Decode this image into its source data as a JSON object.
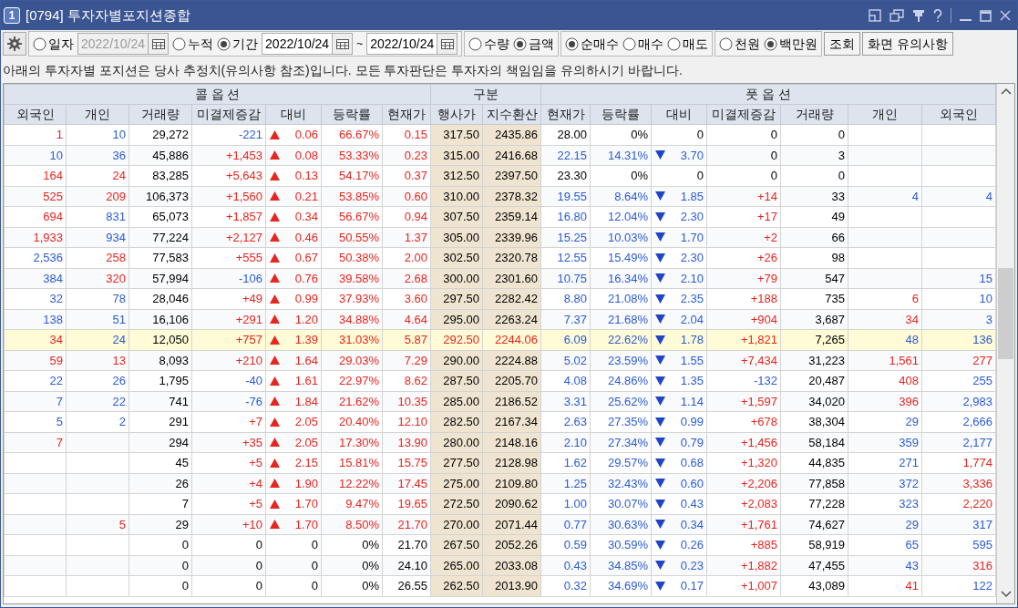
{
  "window": {
    "badge": "1",
    "title": "[0794] 투자자별포지션종합"
  },
  "toolbar": {
    "period_options": [
      {
        "label": "일자",
        "selected": false
      },
      {
        "label": "누적",
        "selected": false
      },
      {
        "label": "기간",
        "selected": true
      }
    ],
    "single_date": {
      "value": "2022/10/24",
      "disabled": true
    },
    "start_date": {
      "value": "2022/10/24",
      "disabled": false
    },
    "range_separator": "~",
    "end_date": {
      "value": "2022/10/24",
      "disabled": false
    },
    "measure_options": [
      {
        "label": "수량",
        "selected": false
      },
      {
        "label": "금액",
        "selected": true
      }
    ],
    "trade_options": [
      {
        "label": "순매수",
        "selected": true
      },
      {
        "label": "매수",
        "selected": false
      },
      {
        "label": "매도",
        "selected": false
      }
    ],
    "unit_options": [
      {
        "label": "천원",
        "selected": false
      },
      {
        "label": "백만원",
        "selected": true
      }
    ],
    "buttons": [
      "조회",
      "화면 유의사항"
    ]
  },
  "notice": "아래의 투자자별 포지션은 당사 추정치(유의사항 참조)입니다. 모든 투자판단은 투자자의 책임임을 유의하시기 바랍니다.",
  "table": {
    "groups": [
      "콜 옵 션",
      "구분",
      "풋 옵 션"
    ],
    "columns": [
      "외국인",
      "개인",
      "거래량",
      "미결제증감",
      "대비",
      "등락률",
      "현재가",
      "행사가",
      "지수환산",
      "현재가",
      "등락률",
      "대비",
      "미결제증감",
      "거래량",
      "개인",
      "외국인"
    ],
    "rows": [
      {
        "selected": false,
        "cells": [
          {
            "text": "1",
            "color": "#e8251e"
          },
          {
            "text": "10",
            "color": "#2a5bd7"
          },
          {
            "text": "29,272"
          },
          {
            "text": "-221",
            "color": "#2a5bd7"
          },
          {
            "text": "0.06",
            "color": "#e8251e",
            "kind": "up"
          },
          {
            "text": "66.67%",
            "color": "#e8251e"
          },
          {
            "text": "0.15",
            "color": "#e8251e"
          },
          {
            "text": "317.50"
          },
          {
            "text": "2435.86"
          },
          {
            "text": "28.00"
          },
          {
            "text": "0%"
          },
          {
            "text": "0"
          },
          {
            "text": "0"
          },
          {
            "text": "0"
          },
          null,
          null
        ]
      },
      {
        "selected": false,
        "cells": [
          {
            "text": "10",
            "color": "#2a5bd7"
          },
          {
            "text": "36",
            "color": "#2a5bd7"
          },
          {
            "text": "45,886"
          },
          {
            "text": "+1,453",
            "color": "#e8251e"
          },
          {
            "text": "0.08",
            "color": "#e8251e",
            "kind": "up"
          },
          {
            "text": "53.33%",
            "color": "#e8251e"
          },
          {
            "text": "0.23",
            "color": "#e8251e"
          },
          {
            "text": "315.00"
          },
          {
            "text": "2416.68"
          },
          {
            "text": "22.15",
            "color": "#2a5bd7"
          },
          {
            "text": "14.31%",
            "color": "#2a5bd7"
          },
          {
            "text": "3.70",
            "color": "#2a5bd7",
            "kind": "down"
          },
          {
            "text": "0"
          },
          {
            "text": "3"
          },
          null,
          null
        ]
      },
      {
        "selected": false,
        "cells": [
          {
            "text": "164",
            "color": "#e8251e"
          },
          {
            "text": "24",
            "color": "#e8251e"
          },
          {
            "text": "83,285"
          },
          {
            "text": "+5,643",
            "color": "#e8251e"
          },
          {
            "text": "0.13",
            "color": "#e8251e",
            "kind": "up"
          },
          {
            "text": "54.17%",
            "color": "#e8251e"
          },
          {
            "text": "0.37",
            "color": "#e8251e"
          },
          {
            "text": "312.50"
          },
          {
            "text": "2397.50"
          },
          {
            "text": "23.30"
          },
          {
            "text": "0%"
          },
          {
            "text": "0"
          },
          {
            "text": "0"
          },
          {
            "text": "0"
          },
          null,
          null
        ]
      },
      {
        "selected": false,
        "cells": [
          {
            "text": "525",
            "color": "#e8251e"
          },
          {
            "text": "209",
            "color": "#e8251e"
          },
          {
            "text": "106,373"
          },
          {
            "text": "+1,560",
            "color": "#e8251e"
          },
          {
            "text": "0.21",
            "color": "#e8251e",
            "kind": "up"
          },
          {
            "text": "53.85%",
            "color": "#e8251e"
          },
          {
            "text": "0.60",
            "color": "#e8251e"
          },
          {
            "text": "310.00"
          },
          {
            "text": "2378.32"
          },
          {
            "text": "19.55",
            "color": "#2a5bd7"
          },
          {
            "text": "8.64%",
            "color": "#2a5bd7"
          },
          {
            "text": "1.85",
            "color": "#2a5bd7",
            "kind": "down"
          },
          {
            "text": "+14",
            "color": "#e8251e"
          },
          {
            "text": "33"
          },
          {
            "text": "4",
            "color": "#2a5bd7"
          },
          {
            "text": "4",
            "color": "#2a5bd7"
          }
        ]
      },
      {
        "selected": false,
        "cells": [
          {
            "text": "694",
            "color": "#e8251e"
          },
          {
            "text": "831",
            "color": "#2a5bd7"
          },
          {
            "text": "65,073"
          },
          {
            "text": "+1,857",
            "color": "#e8251e"
          },
          {
            "text": "0.34",
            "color": "#e8251e",
            "kind": "up"
          },
          {
            "text": "56.67%",
            "color": "#e8251e"
          },
          {
            "text": "0.94",
            "color": "#e8251e"
          },
          {
            "text": "307.50"
          },
          {
            "text": "2359.14"
          },
          {
            "text": "16.80",
            "color": "#2a5bd7"
          },
          {
            "text": "12.04%",
            "color": "#2a5bd7"
          },
          {
            "text": "2.30",
            "color": "#2a5bd7",
            "kind": "down"
          },
          {
            "text": "+17",
            "color": "#e8251e"
          },
          {
            "text": "49"
          },
          null,
          null
        ]
      },
      {
        "selected": false,
        "cells": [
          {
            "text": "1,933",
            "color": "#e8251e"
          },
          {
            "text": "934",
            "color": "#2a5bd7"
          },
          {
            "text": "77,224"
          },
          {
            "text": "+2,127",
            "color": "#e8251e"
          },
          {
            "text": "0.46",
            "color": "#e8251e",
            "kind": "up"
          },
          {
            "text": "50.55%",
            "color": "#e8251e"
          },
          {
            "text": "1.37",
            "color": "#e8251e"
          },
          {
            "text": "305.00"
          },
          {
            "text": "2339.96"
          },
          {
            "text": "15.25",
            "color": "#2a5bd7"
          },
          {
            "text": "10.03%",
            "color": "#2a5bd7"
          },
          {
            "text": "1.70",
            "color": "#2a5bd7",
            "kind": "down"
          },
          {
            "text": "+2",
            "color": "#e8251e"
          },
          {
            "text": "66"
          },
          null,
          null
        ]
      },
      {
        "selected": false,
        "cells": [
          {
            "text": "2,536",
            "color": "#2a5bd7"
          },
          {
            "text": "258",
            "color": "#e8251e"
          },
          {
            "text": "77,583"
          },
          {
            "text": "+555",
            "color": "#e8251e"
          },
          {
            "text": "0.67",
            "color": "#e8251e",
            "kind": "up"
          },
          {
            "text": "50.38%",
            "color": "#e8251e"
          },
          {
            "text": "2.00",
            "color": "#e8251e"
          },
          {
            "text": "302.50"
          },
          {
            "text": "2320.78"
          },
          {
            "text": "12.55",
            "color": "#2a5bd7"
          },
          {
            "text": "15.49%",
            "color": "#2a5bd7"
          },
          {
            "text": "2.30",
            "color": "#2a5bd7",
            "kind": "down"
          },
          {
            "text": "+26",
            "color": "#e8251e"
          },
          {
            "text": "98"
          },
          null,
          null
        ]
      },
      {
        "selected": false,
        "cells": [
          {
            "text": "384",
            "color": "#2a5bd7"
          },
          {
            "text": "320",
            "color": "#e8251e"
          },
          {
            "text": "57,994"
          },
          {
            "text": "-106",
            "color": "#2a5bd7"
          },
          {
            "text": "0.76",
            "color": "#e8251e",
            "kind": "up"
          },
          {
            "text": "39.58%",
            "color": "#e8251e"
          },
          {
            "text": "2.68",
            "color": "#e8251e"
          },
          {
            "text": "300.00"
          },
          {
            "text": "2301.60"
          },
          {
            "text": "10.75",
            "color": "#2a5bd7"
          },
          {
            "text": "16.34%",
            "color": "#2a5bd7"
          },
          {
            "text": "2.10",
            "color": "#2a5bd7",
            "kind": "down"
          },
          {
            "text": "+79",
            "color": "#e8251e"
          },
          {
            "text": "547"
          },
          null,
          {
            "text": "15",
            "color": "#2a5bd7"
          }
        ]
      },
      {
        "selected": false,
        "cells": [
          {
            "text": "32",
            "color": "#2a5bd7"
          },
          {
            "text": "78",
            "color": "#2a5bd7"
          },
          {
            "text": "28,046"
          },
          {
            "text": "+49",
            "color": "#e8251e"
          },
          {
            "text": "0.99",
            "color": "#e8251e",
            "kind": "up"
          },
          {
            "text": "37.93%",
            "color": "#e8251e"
          },
          {
            "text": "3.60",
            "color": "#e8251e"
          },
          {
            "text": "297.50"
          },
          {
            "text": "2282.42"
          },
          {
            "text": "8.80",
            "color": "#2a5bd7"
          },
          {
            "text": "21.08%",
            "color": "#2a5bd7"
          },
          {
            "text": "2.35",
            "color": "#2a5bd7",
            "kind": "down"
          },
          {
            "text": "+188",
            "color": "#e8251e"
          },
          {
            "text": "735"
          },
          {
            "text": "6",
            "color": "#e8251e"
          },
          {
            "text": "10",
            "color": "#2a5bd7"
          }
        ]
      },
      {
        "selected": false,
        "cells": [
          {
            "text": "138",
            "color": "#2a5bd7"
          },
          {
            "text": "51",
            "color": "#2a5bd7"
          },
          {
            "text": "16,106"
          },
          {
            "text": "+291",
            "color": "#e8251e"
          },
          {
            "text": "1.20",
            "color": "#e8251e",
            "kind": "up"
          },
          {
            "text": "34.88%",
            "color": "#e8251e"
          },
          {
            "text": "4.64",
            "color": "#e8251e"
          },
          {
            "text": "295.00"
          },
          {
            "text": "2263.24"
          },
          {
            "text": "7.37",
            "color": "#2a5bd7"
          },
          {
            "text": "21.68%",
            "color": "#2a5bd7"
          },
          {
            "text": "2.04",
            "color": "#2a5bd7",
            "kind": "down"
          },
          {
            "text": "+904",
            "color": "#e8251e"
          },
          {
            "text": "3,687"
          },
          {
            "text": "34",
            "color": "#e8251e"
          },
          {
            "text": "3",
            "color": "#2a5bd7"
          }
        ]
      },
      {
        "selected": true,
        "cells": [
          {
            "text": "34",
            "color": "#e8251e"
          },
          {
            "text": "24",
            "color": "#2a5bd7"
          },
          {
            "text": "12,050"
          },
          {
            "text": "+757",
            "color": "#e8251e"
          },
          {
            "text": "1.39",
            "color": "#e8251e",
            "kind": "up"
          },
          {
            "text": "31.03%",
            "color": "#e8251e"
          },
          {
            "text": "5.87",
            "color": "#e8251e"
          },
          {
            "text": "292.50",
            "color": "#e8251e"
          },
          {
            "text": "2244.06",
            "color": "#e8251e"
          },
          {
            "text": "6.09",
            "color": "#2a5bd7"
          },
          {
            "text": "22.62%",
            "color": "#2a5bd7"
          },
          {
            "text": "1.78",
            "color": "#2a5bd7",
            "kind": "down"
          },
          {
            "text": "+1,821",
            "color": "#e8251e"
          },
          {
            "text": "7,265"
          },
          {
            "text": "48",
            "color": "#2a5bd7"
          },
          {
            "text": "136",
            "color": "#2a5bd7"
          }
        ]
      },
      {
        "selected": false,
        "cells": [
          {
            "text": "59",
            "color": "#e8251e"
          },
          {
            "text": "13",
            "color": "#e8251e"
          },
          {
            "text": "8,093"
          },
          {
            "text": "+210",
            "color": "#e8251e"
          },
          {
            "text": "1.64",
            "color": "#e8251e",
            "kind": "up"
          },
          {
            "text": "29.03%",
            "color": "#e8251e"
          },
          {
            "text": "7.29",
            "color": "#e8251e"
          },
          {
            "text": "290.00"
          },
          {
            "text": "2224.88"
          },
          {
            "text": "5.02",
            "color": "#2a5bd7"
          },
          {
            "text": "23.59%",
            "color": "#2a5bd7"
          },
          {
            "text": "1.55",
            "color": "#2a5bd7",
            "kind": "down"
          },
          {
            "text": "+7,434",
            "color": "#e8251e"
          },
          {
            "text": "31,223"
          },
          {
            "text": "1,561",
            "color": "#e8251e"
          },
          {
            "text": "277",
            "color": "#e8251e"
          }
        ]
      },
      {
        "selected": false,
        "cells": [
          {
            "text": "22",
            "color": "#2a5bd7"
          },
          {
            "text": "26",
            "color": "#2a5bd7"
          },
          {
            "text": "1,795"
          },
          {
            "text": "-40",
            "color": "#2a5bd7"
          },
          {
            "text": "1.61",
            "color": "#e8251e",
            "kind": "up"
          },
          {
            "text": "22.97%",
            "color": "#e8251e"
          },
          {
            "text": "8.62",
            "color": "#e8251e"
          },
          {
            "text": "287.50"
          },
          {
            "text": "2205.70"
          },
          {
            "text": "4.08",
            "color": "#2a5bd7"
          },
          {
            "text": "24.86%",
            "color": "#2a5bd7"
          },
          {
            "text": "1.35",
            "color": "#2a5bd7",
            "kind": "down"
          },
          {
            "text": "-132",
            "color": "#2a5bd7"
          },
          {
            "text": "20,487"
          },
          {
            "text": "408",
            "color": "#e8251e"
          },
          {
            "text": "255",
            "color": "#2a5bd7"
          }
        ]
      },
      {
        "selected": false,
        "cells": [
          {
            "text": "7",
            "color": "#2a5bd7"
          },
          {
            "text": "22",
            "color": "#2a5bd7"
          },
          {
            "text": "741"
          },
          {
            "text": "-76",
            "color": "#2a5bd7"
          },
          {
            "text": "1.84",
            "color": "#e8251e",
            "kind": "up"
          },
          {
            "text": "21.62%",
            "color": "#e8251e"
          },
          {
            "text": "10.35",
            "color": "#e8251e"
          },
          {
            "text": "285.00"
          },
          {
            "text": "2186.52"
          },
          {
            "text": "3.31",
            "color": "#2a5bd7"
          },
          {
            "text": "25.62%",
            "color": "#2a5bd7"
          },
          {
            "text": "1.14",
            "color": "#2a5bd7",
            "kind": "down"
          },
          {
            "text": "+1,597",
            "color": "#e8251e"
          },
          {
            "text": "34,020"
          },
          {
            "text": "396",
            "color": "#e8251e"
          },
          {
            "text": "2,983",
            "color": "#2a5bd7"
          }
        ]
      },
      {
        "selected": false,
        "cells": [
          {
            "text": "5",
            "color": "#2a5bd7"
          },
          {
            "text": "2",
            "color": "#2a5bd7"
          },
          {
            "text": "291"
          },
          {
            "text": "+7",
            "color": "#e8251e"
          },
          {
            "text": "2.05",
            "color": "#e8251e",
            "kind": "up"
          },
          {
            "text": "20.40%",
            "color": "#e8251e"
          },
          {
            "text": "12.10",
            "color": "#e8251e"
          },
          {
            "text": "282.50"
          },
          {
            "text": "2167.34"
          },
          {
            "text": "2.63",
            "color": "#2a5bd7"
          },
          {
            "text": "27.35%",
            "color": "#2a5bd7"
          },
          {
            "text": "0.99",
            "color": "#2a5bd7",
            "kind": "down"
          },
          {
            "text": "+678",
            "color": "#e8251e"
          },
          {
            "text": "38,304"
          },
          {
            "text": "29",
            "color": "#2a5bd7"
          },
          {
            "text": "2,666",
            "color": "#2a5bd7"
          }
        ]
      },
      {
        "selected": false,
        "cells": [
          {
            "text": "7",
            "color": "#e8251e"
          },
          null,
          {
            "text": "294"
          },
          {
            "text": "+35",
            "color": "#e8251e"
          },
          {
            "text": "2.05",
            "color": "#e8251e",
            "kind": "up"
          },
          {
            "text": "17.30%",
            "color": "#e8251e"
          },
          {
            "text": "13.90",
            "color": "#e8251e"
          },
          {
            "text": "280.00"
          },
          {
            "text": "2148.16"
          },
          {
            "text": "2.10",
            "color": "#2a5bd7"
          },
          {
            "text": "27.34%",
            "color": "#2a5bd7"
          },
          {
            "text": "0.79",
            "color": "#2a5bd7",
            "kind": "down"
          },
          {
            "text": "+1,456",
            "color": "#e8251e"
          },
          {
            "text": "58,184"
          },
          {
            "text": "359",
            "color": "#2a5bd7"
          },
          {
            "text": "2,177",
            "color": "#2a5bd7"
          }
        ]
      },
      {
        "selected": false,
        "cells": [
          null,
          null,
          {
            "text": "45"
          },
          {
            "text": "+5",
            "color": "#e8251e"
          },
          {
            "text": "2.15",
            "color": "#e8251e",
            "kind": "up"
          },
          {
            "text": "15.81%",
            "color": "#e8251e"
          },
          {
            "text": "15.75",
            "color": "#e8251e"
          },
          {
            "text": "277.50"
          },
          {
            "text": "2128.98"
          },
          {
            "text": "1.62",
            "color": "#2a5bd7"
          },
          {
            "text": "29.57%",
            "color": "#2a5bd7"
          },
          {
            "text": "0.68",
            "color": "#2a5bd7",
            "kind": "down"
          },
          {
            "text": "+1,320",
            "color": "#e8251e"
          },
          {
            "text": "44,835"
          },
          {
            "text": "271",
            "color": "#2a5bd7"
          },
          {
            "text": "1,774",
            "color": "#e8251e"
          }
        ]
      },
      {
        "selected": false,
        "cells": [
          null,
          null,
          {
            "text": "26"
          },
          {
            "text": "+4",
            "color": "#e8251e"
          },
          {
            "text": "1.90",
            "color": "#e8251e",
            "kind": "up"
          },
          {
            "text": "12.22%",
            "color": "#e8251e"
          },
          {
            "text": "17.45",
            "color": "#e8251e"
          },
          {
            "text": "275.00"
          },
          {
            "text": "2109.80"
          },
          {
            "text": "1.25",
            "color": "#2a5bd7"
          },
          {
            "text": "32.43%",
            "color": "#2a5bd7"
          },
          {
            "text": "0.60",
            "color": "#2a5bd7",
            "kind": "down"
          },
          {
            "text": "+2,206",
            "color": "#e8251e"
          },
          {
            "text": "77,858"
          },
          {
            "text": "372",
            "color": "#2a5bd7"
          },
          {
            "text": "3,336",
            "color": "#e8251e"
          }
        ]
      },
      {
        "selected": false,
        "cells": [
          null,
          null,
          {
            "text": "7"
          },
          {
            "text": "+5",
            "color": "#e8251e"
          },
          {
            "text": "1.70",
            "color": "#e8251e",
            "kind": "up"
          },
          {
            "text": "9.47%",
            "color": "#e8251e"
          },
          {
            "text": "19.65",
            "color": "#e8251e"
          },
          {
            "text": "272.50"
          },
          {
            "text": "2090.62"
          },
          {
            "text": "1.00",
            "color": "#2a5bd7"
          },
          {
            "text": "30.07%",
            "color": "#2a5bd7"
          },
          {
            "text": "0.43",
            "color": "#2a5bd7",
            "kind": "down"
          },
          {
            "text": "+2,083",
            "color": "#e8251e"
          },
          {
            "text": "77,228"
          },
          {
            "text": "323",
            "color": "#2a5bd7"
          },
          {
            "text": "2,220",
            "color": "#e8251e"
          }
        ]
      },
      {
        "selected": false,
        "cells": [
          null,
          {
            "text": "5",
            "color": "#e8251e"
          },
          {
            "text": "29"
          },
          {
            "text": "+10",
            "color": "#e8251e"
          },
          {
            "text": "1.70",
            "color": "#e8251e",
            "kind": "up"
          },
          {
            "text": "8.50%",
            "color": "#e8251e"
          },
          {
            "text": "21.70",
            "color": "#e8251e"
          },
          {
            "text": "270.00"
          },
          {
            "text": "2071.44"
          },
          {
            "text": "0.77",
            "color": "#2a5bd7"
          },
          {
            "text": "30.63%",
            "color": "#2a5bd7"
          },
          {
            "text": "0.34",
            "color": "#2a5bd7",
            "kind": "down"
          },
          {
            "text": "+1,761",
            "color": "#e8251e"
          },
          {
            "text": "74,627"
          },
          {
            "text": "29",
            "color": "#2a5bd7"
          },
          {
            "text": "317",
            "color": "#2a5bd7"
          }
        ]
      },
      {
        "selected": false,
        "cells": [
          null,
          null,
          {
            "text": "0"
          },
          {
            "text": "0"
          },
          {
            "text": "0"
          },
          {
            "text": "0%"
          },
          {
            "text": "21.70"
          },
          {
            "text": "267.50"
          },
          {
            "text": "2052.26"
          },
          {
            "text": "0.59",
            "color": "#2a5bd7"
          },
          {
            "text": "30.59%",
            "color": "#2a5bd7"
          },
          {
            "text": "0.26",
            "color": "#2a5bd7",
            "kind": "down"
          },
          {
            "text": "+885",
            "color": "#e8251e"
          },
          {
            "text": "58,919"
          },
          {
            "text": "65",
            "color": "#2a5bd7"
          },
          {
            "text": "595",
            "color": "#2a5bd7"
          }
        ]
      },
      {
        "selected": false,
        "cells": [
          null,
          null,
          {
            "text": "0"
          },
          {
            "text": "0"
          },
          {
            "text": "0"
          },
          {
            "text": "0%"
          },
          {
            "text": "24.10"
          },
          {
            "text": "265.00"
          },
          {
            "text": "2033.08"
          },
          {
            "text": "0.43",
            "color": "#2a5bd7"
          },
          {
            "text": "34.85%",
            "color": "#2a5bd7"
          },
          {
            "text": "0.23",
            "color": "#2a5bd7",
            "kind": "down"
          },
          {
            "text": "+1,882",
            "color": "#e8251e"
          },
          {
            "text": "47,455"
          },
          {
            "text": "43",
            "color": "#2a5bd7"
          },
          {
            "text": "316",
            "color": "#e8251e"
          }
        ]
      },
      {
        "selected": false,
        "cells": [
          null,
          null,
          {
            "text": "0"
          },
          {
            "text": "0"
          },
          {
            "text": "0"
          },
          {
            "text": "0%"
          },
          {
            "text": "26.55"
          },
          {
            "text": "262.50"
          },
          {
            "text": "2013.90"
          },
          {
            "text": "0.32",
            "color": "#2a5bd7"
          },
          {
            "text": "34.69%",
            "color": "#2a5bd7"
          },
          {
            "text": "0.17",
            "color": "#2a5bd7",
            "kind": "down"
          },
          {
            "text": "+1,007",
            "color": "#e8251e"
          },
          {
            "text": "43,089"
          },
          {
            "text": "41",
            "color": "#e8251e"
          },
          {
            "text": "122",
            "color": "#2a5bd7"
          }
        ]
      }
    ]
  }
}
